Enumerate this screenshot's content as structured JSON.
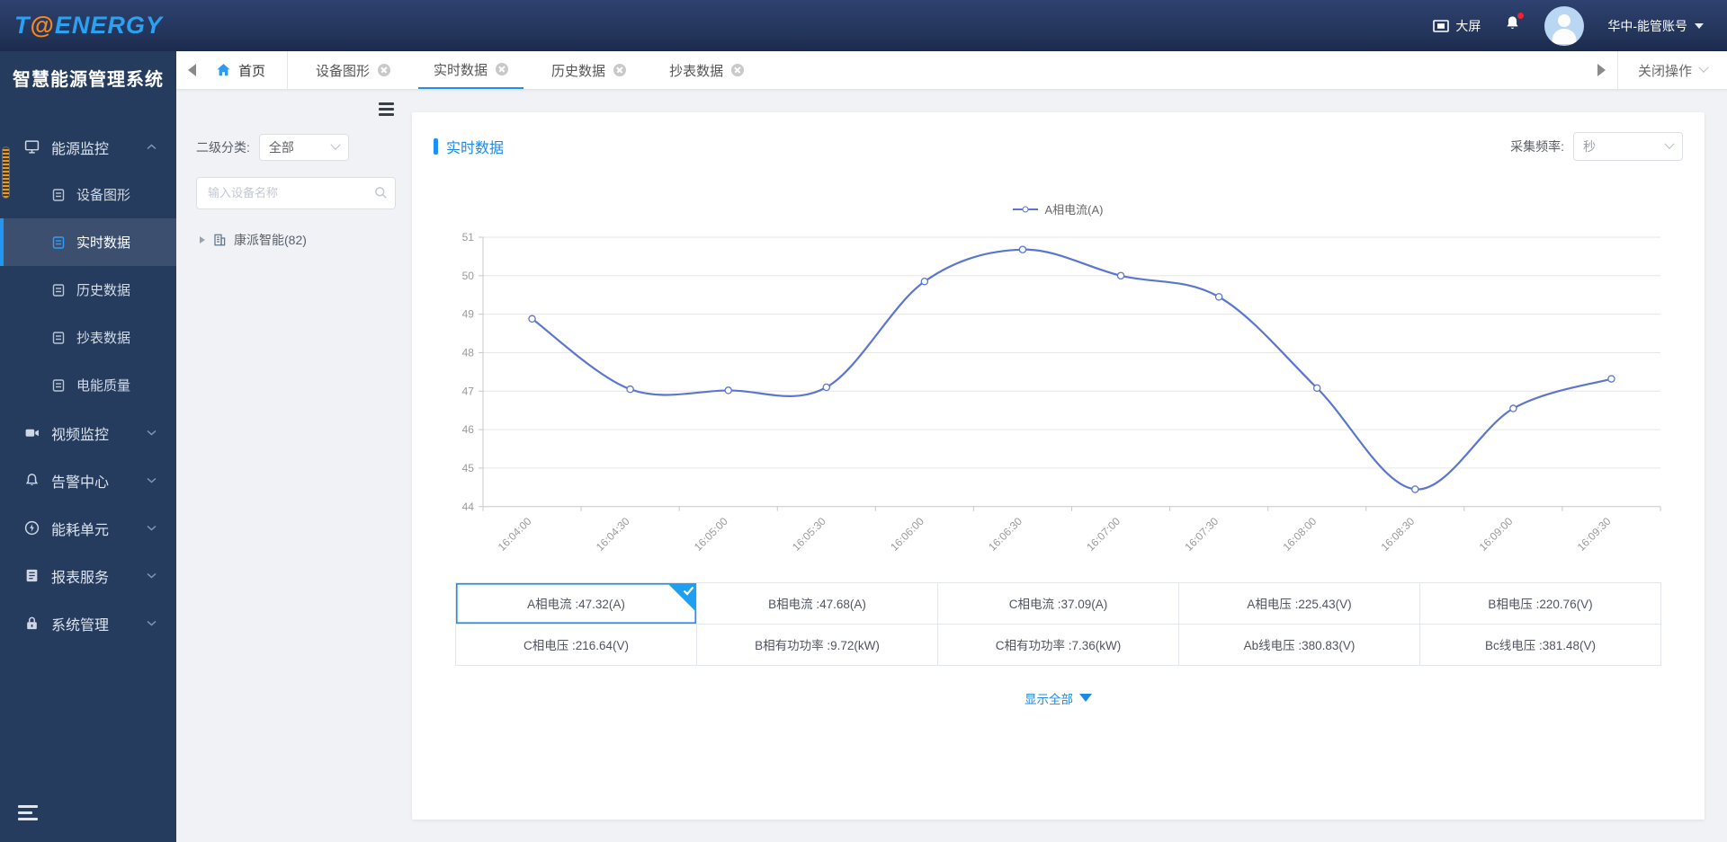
{
  "header": {
    "logo": {
      "t": "T",
      "at": "@",
      "energy": "ENERGY"
    },
    "big_screen_label": "大屏",
    "account_name": "华中-能管账号"
  },
  "sidebar": {
    "title": "智慧能源管理系统",
    "sections": [
      {
        "label": "能源监控",
        "icon": "energy-monitor-icon",
        "expanded": true,
        "children": [
          "设备图形",
          "实时数据",
          "历史数据",
          "抄表数据",
          "电能质量"
        ],
        "active_child": "实时数据"
      },
      {
        "label": "视频监控",
        "icon": "video-icon"
      },
      {
        "label": "告警中心",
        "icon": "alarm-icon"
      },
      {
        "label": "能耗单元",
        "icon": "energy-unit-icon"
      },
      {
        "label": "报表服务",
        "icon": "report-icon"
      },
      {
        "label": "系统管理",
        "icon": "system-icon"
      }
    ]
  },
  "tabs": {
    "back_home": "首页",
    "items": [
      "设备图形",
      "实时数据",
      "历史数据",
      "抄表数据"
    ],
    "active": "实时数据",
    "close_menu": "关闭操作"
  },
  "filter_panel": {
    "category_label": "二级分类:",
    "category_value": "全部",
    "search_placeholder": "输入设备名称",
    "tree_root": "康派智能(82)"
  },
  "main_card": {
    "title": "实时数据",
    "frequency_label": "采集频率:",
    "frequency_value": "秒",
    "show_all_label": "显示全部"
  },
  "chart_data": {
    "type": "line",
    "title": "",
    "legend": "A相电流(A)",
    "x": [
      "16:04:00",
      "16:04:30",
      "16:05:00",
      "16:05:30",
      "16:06:00",
      "16:06:30",
      "16:07:00",
      "16:07:30",
      "16:08:00",
      "16:08:30",
      "16:09:00",
      "16:09:30"
    ],
    "series": [
      {
        "name": "A相电流(A)",
        "values": [
          48.88,
          47.05,
          47.02,
          47.1,
          49.85,
          50.68,
          50.0,
          49.45,
          47.08,
          44.45,
          46.55,
          47.32
        ]
      }
    ],
    "ylim": [
      44,
      51
    ],
    "ytick_step": 1,
    "grid": true,
    "smooth": true,
    "legend_position": "top-center",
    "xlabel_rotate": 45,
    "line_color": "#5b76ce"
  },
  "table": {
    "selected": {
      "row": 0,
      "col": 0
    },
    "rows": [
      [
        "A相电流 :47.32(A)",
        "B相电流 :47.68(A)",
        "C相电流 :37.09(A)",
        "A相电压 :225.43(V)",
        "B相电压 :220.76(V)"
      ],
      [
        "C相电压 :216.64(V)",
        "B相有功功率 :9.72(kW)",
        "C相有功功率 :7.36(kW)",
        "Ab线电压 :380.83(V)",
        "Bc线电压 :381.48(V)"
      ]
    ]
  },
  "colors": {
    "accent": "#1e90f5",
    "line": "#5b76ce",
    "logo_blue": "#2aa2f2",
    "logo_orange": "#f5891d",
    "header_navy": "#233459",
    "sidebar_navy": "#263c5e",
    "selected_corner": "#1e9ff2",
    "alert_red": "#f5222d"
  }
}
